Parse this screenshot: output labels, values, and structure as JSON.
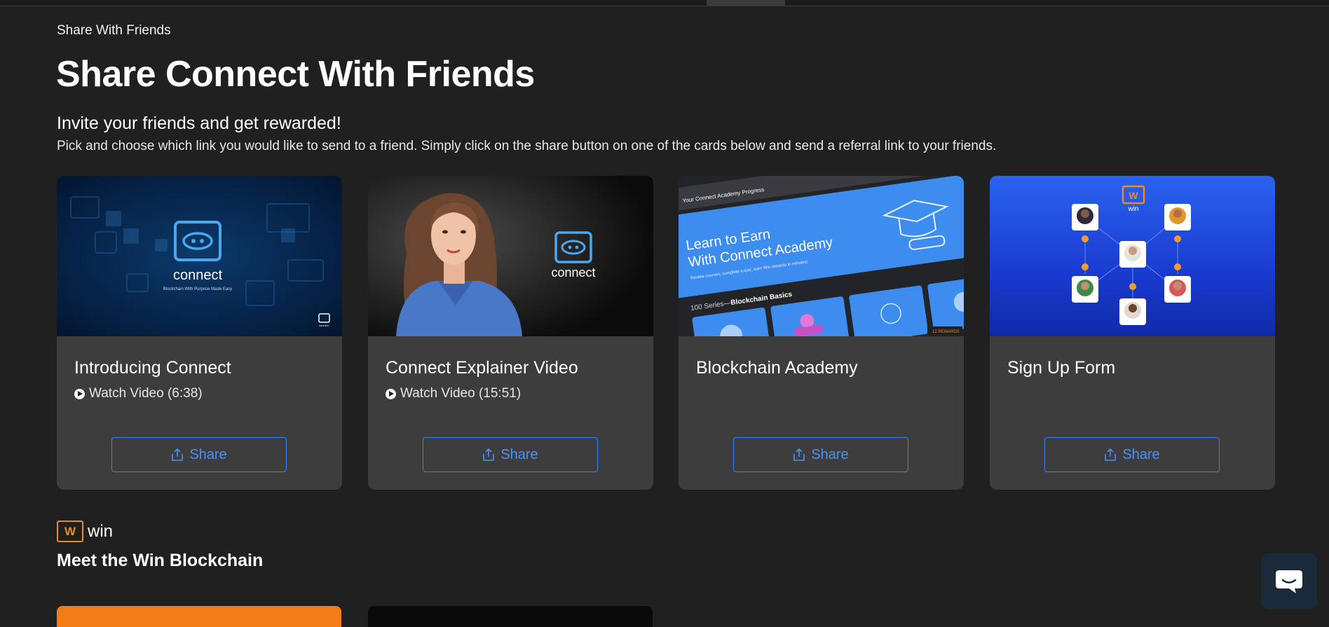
{
  "breadcrumb": "Share With Friends",
  "title": "Share Connect With Friends",
  "subtitle": "Invite your friends and get rewarded!",
  "description": "Pick and choose which link you would like to send to a friend. Simply click on the share button on one of the cards below and send a referral link to your friends.",
  "cards": [
    {
      "title": "Introducing Connect",
      "meta": "Watch Video (6:38)",
      "share_label": "Share",
      "thumb": {
        "logo_text": "connect",
        "tagline": "Blockchain With Purpose Made Easy",
        "corner_text": "connect"
      }
    },
    {
      "title": "Connect Explainer Video",
      "meta": "Watch Video (15:51)",
      "share_label": "Share",
      "thumb": {
        "logo_text": "connect"
      }
    },
    {
      "title": "Blockchain Academy",
      "meta": "",
      "share_label": "Share",
      "thumb": {
        "header": "Your Connect Academy Progress",
        "banner_line1": "Learn to Earn",
        "banner_line2": "With Connect Academy",
        "banner_sub": "Review courses, complete a quiz, earn Win rewards in minutes!",
        "series_label": "100 Series—",
        "series_name": "Blockchain Basics",
        "badge": "12 REWARDS"
      }
    },
    {
      "title": "Sign Up Form",
      "meta": "",
      "share_label": "Share",
      "thumb": {
        "logo_text": "win"
      }
    }
  ],
  "win_section": {
    "logo_letter": "W",
    "logo_text": "win",
    "title": "Meet the Win Blockchain"
  },
  "colors": {
    "accent": "#3d82f0",
    "card_bg": "#3d3d3d",
    "page_bg": "#202020",
    "win_orange": "#f08a1c"
  }
}
